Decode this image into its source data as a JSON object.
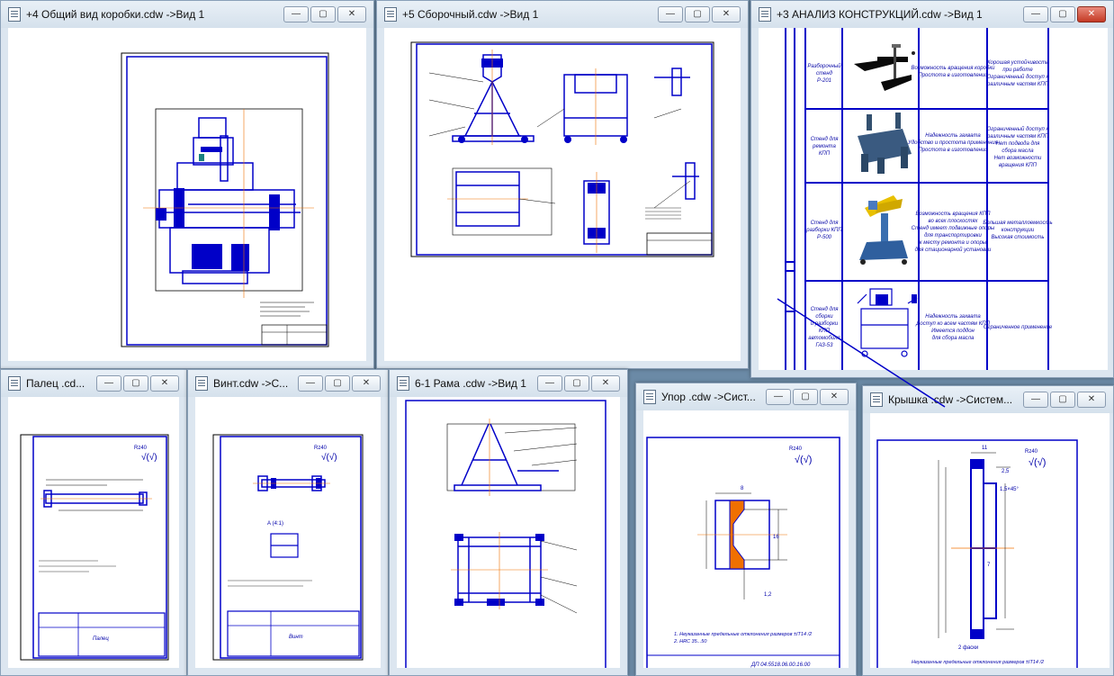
{
  "windows": {
    "w1": {
      "title": "+4 Общий вид коробки.cdw ->Вид 1"
    },
    "w2": {
      "title": "+5 Сборочный.cdw ->Вид 1"
    },
    "w3": {
      "title": "+3 АНАЛИЗ КОНСТРУКЦИЙ.cdw ->Вид 1"
    },
    "w4": {
      "title": "Палец .cd..."
    },
    "w5": {
      "title": "Винт.cdw ->С..."
    },
    "w6": {
      "title": "6-1 Рама .cdw ->Вид 1"
    },
    "w7": {
      "title": "Упор .cdw ->Сист..."
    },
    "w8": {
      "title": "Крышка .cdw ->Систем..."
    }
  },
  "controls": {
    "minimize": "—",
    "maximize": "▢",
    "close": "✕"
  },
  "analysis_table": {
    "rows": [
      {
        "name": [
          "Разборочный",
          "стенд",
          "Р-201"
        ],
        "adv": [
          "Возможность вращения коробки",
          "Простота в изготовлении"
        ],
        "dis": [
          "Хорошая устойчивость",
          "при работе",
          "Ограниченный доступ к",
          "различным частям КПП"
        ]
      },
      {
        "name": [
          "Стенд для",
          "ремонта",
          "КПП"
        ],
        "adv": [
          "Надежность захвата",
          "Удобство и простота применения",
          "Простота в изготовлении"
        ],
        "dis": [
          "Ограниченный доступ к",
          "различным частям КПП",
          "Нет подвода для",
          "сбора масла",
          "Нет возможности",
          "вращения КПП"
        ]
      },
      {
        "name": [
          "Стенд для",
          "разборки КПП",
          "Р-500"
        ],
        "adv": [
          "Возможность вращения КПП",
          "во всех плоскостях",
          "Стенд имеет подвижные опоры",
          "для транспортировки",
          "к месту ремонта и опоры",
          "для стационарной установки"
        ],
        "dis": [
          "Большая металлоемкость",
          "конструкции",
          "Высокая стоимость"
        ]
      },
      {
        "name": [
          "Стенд для",
          "сборки",
          "и разборки",
          "КПП",
          "автомобиля",
          "ГАЗ-53"
        ],
        "adv": [
          "Надежность захвата",
          "Доступ ко всем частям КПП",
          "Имеется поддон",
          "для сбора масла"
        ],
        "dis": [
          "Ограниченное применение"
        ]
      }
    ]
  },
  "drawings": {
    "roughness_a": "Rz40",
    "roughness_b": "Rz40",
    "roughness_c": "Rz40",
    "roughness_d": "Rz40",
    "roughness_e": "Rz40",
    "check_mark": "√(√)",
    "palec_part": "Палец",
    "vint_part": "Винт",
    "vint_section": "А (4:1)",
    "upor_note1": "1. Неуказанные предельные отклонения размеров ±IT14 /2",
    "upor_note2": "2. HRC 35...50",
    "upor_code": "ДП 04.5518.06.00.16.00",
    "kryshka_note": "Неуказанные предельные отклонения размеров ±IT14 /2",
    "upor_dim_top": "8",
    "upor_dim_16": "16",
    "upor_dim_12": "1,2",
    "kryshka_dim_11": "11",
    "kryshka_dim_25": "2,5",
    "kryshka_dim_chamfer": "1,5×45°",
    "kryshka_dim_7": "7",
    "kryshka_dim_2f": "2 фаски"
  }
}
